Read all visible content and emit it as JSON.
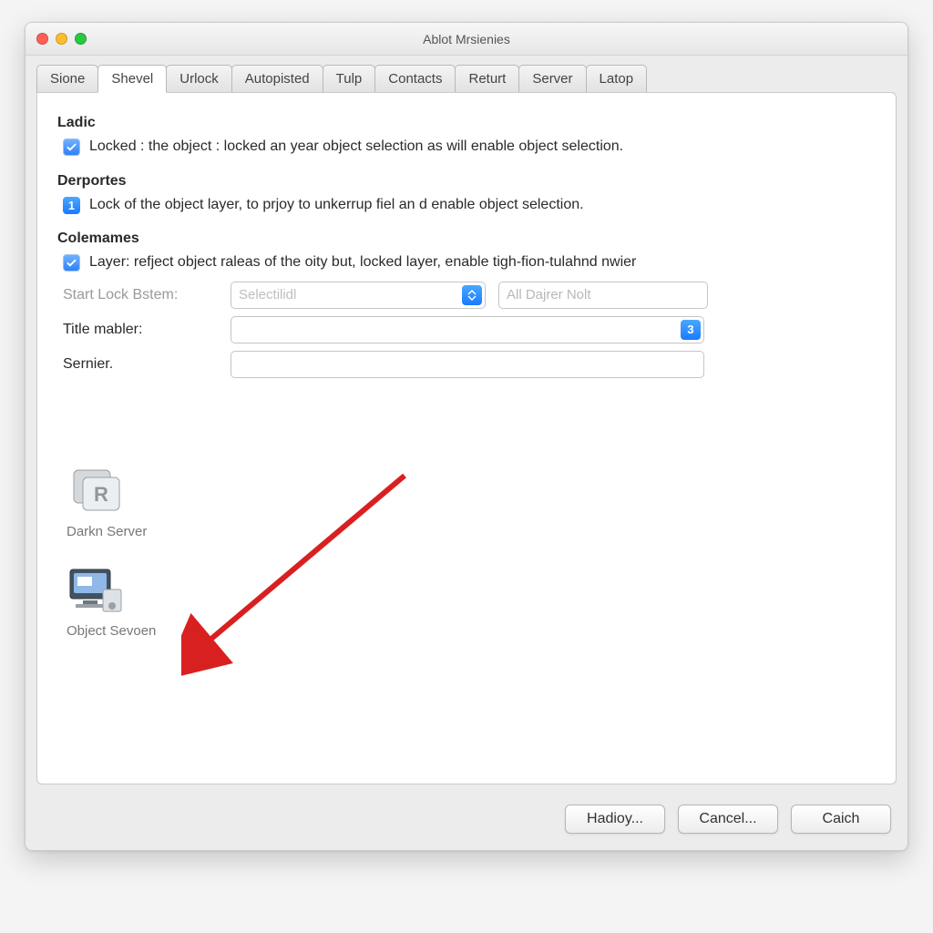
{
  "window": {
    "title": "Ablot Mrsienies"
  },
  "tabs": [
    {
      "label": "Sione",
      "active": false
    },
    {
      "label": "Shevel",
      "active": true
    },
    {
      "label": "Urlock",
      "active": false
    },
    {
      "label": "Autopisted",
      "active": false
    },
    {
      "label": "Tulp",
      "active": false
    },
    {
      "label": "Contacts",
      "active": false
    },
    {
      "label": "Returt",
      "active": false
    },
    {
      "label": "Server",
      "active": false
    },
    {
      "label": "Latop",
      "active": false
    }
  ],
  "sections": {
    "ladic": {
      "title": "Ladic",
      "checked": true,
      "text": "Locked : the  object : locked an year object selection as will enable object selection."
    },
    "derportes": {
      "title": "Derportes",
      "badge": "1",
      "text": "Lock of the object layer, to prjoy to unkerrup fiel an d enable object selection."
    },
    "colemames": {
      "title": "Colemames",
      "checked": true,
      "text": "Layer: refject object raleas of the oity but, locked layer, enable tigh-fion-tulahnd nwier"
    }
  },
  "form": {
    "startLock": {
      "label": "Start Lock Bstem:",
      "select_placeholder": "Selectilidl",
      "text_placeholder": "All Dajrer Nolt"
    },
    "titleMabler": {
      "label": "Title mabler:",
      "stepper_value": "3"
    },
    "sernier": {
      "label": "Sernier.",
      "value": ""
    }
  },
  "iconItems": [
    {
      "id": "darkn-server",
      "label": "Darkn Server",
      "glyph": "R"
    },
    {
      "id": "object-sevoen",
      "label": "Object Sevoen",
      "glyph": ""
    }
  ],
  "buttons": {
    "apply": "Hadioy...",
    "cancel": "Cancel...",
    "ok": "Caich"
  }
}
